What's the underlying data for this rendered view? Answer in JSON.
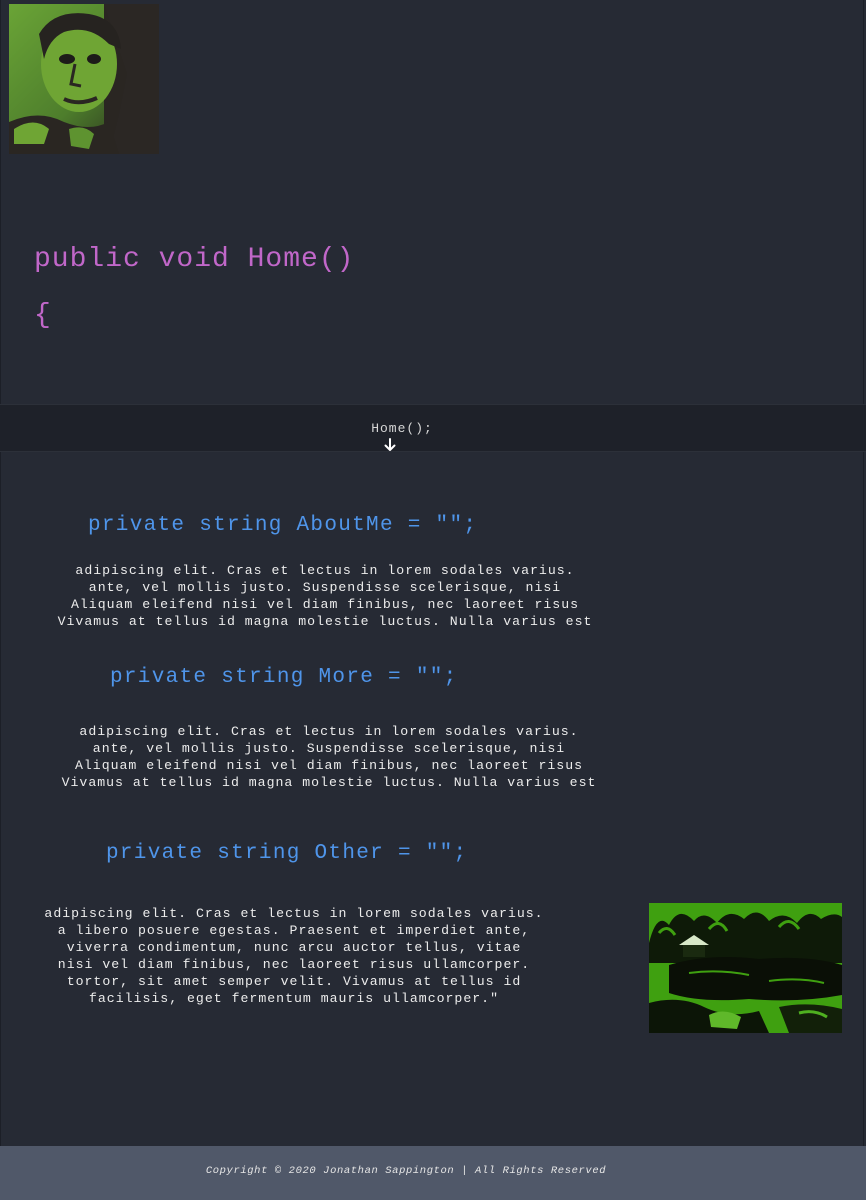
{
  "header": {
    "avatar_icon": "profile-portrait"
  },
  "hero": {
    "signature": "public void Home()",
    "brace": "{"
  },
  "nav": {
    "link_label": "Home();",
    "arrow_icon": "arrow-down-icon"
  },
  "sections": {
    "about": {
      "heading": "private string AboutMe = \"\";",
      "lines": [
        "adipiscing elit. Cras et lectus in lorem sodales varius.",
        "ante, vel mollis justo. Suspendisse scelerisque, nisi",
        "Aliquam eleifend nisi vel diam finibus, nec laoreet risus",
        "Vivamus at tellus id magna molestie luctus. Nulla varius est"
      ]
    },
    "more": {
      "heading": "private string More = \"\";",
      "lines": [
        "adipiscing elit. Cras et lectus in lorem sodales varius.",
        "ante, vel mollis justo. Suspendisse scelerisque, nisi",
        "Aliquam eleifend nisi vel diam finibus, nec laoreet risus",
        "Vivamus at tellus id magna molestie luctus. Nulla varius est"
      ]
    },
    "other": {
      "heading": "private string Other = \"\";",
      "lines": [
        "adipiscing elit. Cras et lectus in lorem sodales varius.",
        "a libero posuere egestas. Praesent et imperdiet ante,",
        "viverra condimentum, nunc arcu auctor tellus, vitae",
        "nisi vel diam finibus, nec laoreet risus ullamcorper.",
        "tortor, sit amet semper velit. Vivamus at tellus id",
        "facilisis, eget fermentum mauris ullamcorper.\""
      ],
      "photo_icon": "park-pond-photo"
    }
  },
  "footer": {
    "copyright": "Copyright © 2020 Jonathan Sappington | All Rights Reserved"
  },
  "colors": {
    "background": "#262a34",
    "hero_text": "#c167c9",
    "heading_text": "#4f95ea",
    "nav_bg": "#1e2129",
    "footer_bg": "#505869",
    "image_green": "#6fa534"
  }
}
